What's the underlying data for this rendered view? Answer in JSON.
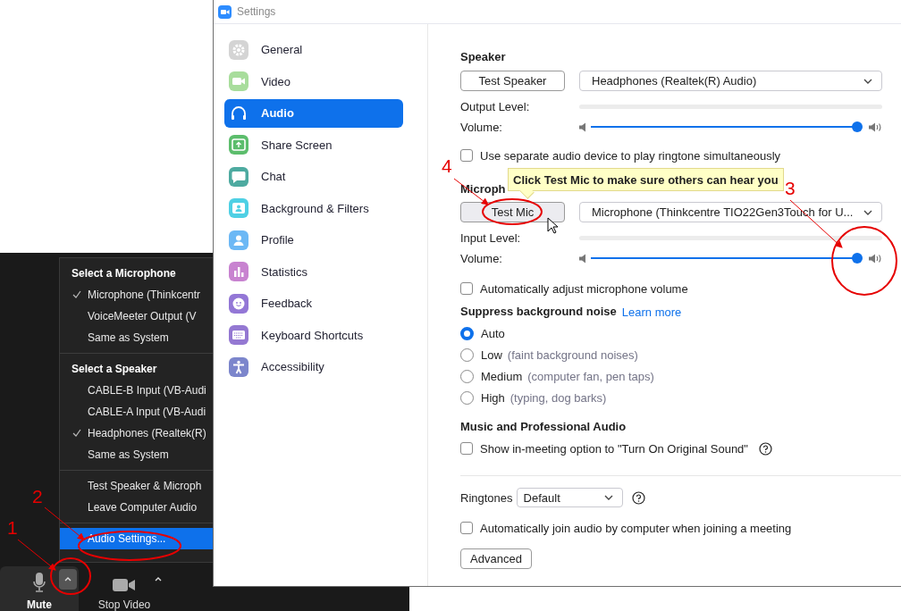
{
  "meeting": {
    "audio_menu": {
      "sections": [
        {
          "heading": "Select a Microphone",
          "items": [
            {
              "label": "Microphone (Thinkcentr",
              "checked": true,
              "selected": false
            },
            {
              "label": "VoiceMeeter Output (V",
              "checked": false,
              "selected": false
            },
            {
              "label": "Same as System",
              "checked": false,
              "selected": false
            }
          ]
        },
        {
          "heading": "Select a Speaker",
          "items": [
            {
              "label": "CABLE-B Input (VB-Audi",
              "checked": false,
              "selected": false
            },
            {
              "label": "CABLE-A Input (VB-Audi",
              "checked": false,
              "selected": false
            },
            {
              "label": "Headphones (Realtek(R)",
              "checked": true,
              "selected": false
            },
            {
              "label": "Same as System",
              "checked": false,
              "selected": false
            }
          ]
        },
        {
          "items": [
            {
              "label": "Test Speaker & Microph",
              "checked": false,
              "selected": false
            },
            {
              "label": "Leave Computer Audio",
              "checked": false,
              "selected": false
            }
          ]
        },
        {
          "items": [
            {
              "label": "Audio Settings...",
              "checked": false,
              "selected": true
            }
          ]
        }
      ]
    },
    "toolbar": [
      {
        "label": "Mute",
        "kind": "mic",
        "highlighted": true,
        "caret_highlighted": true
      },
      {
        "label": "Stop Video",
        "kind": "video",
        "highlighted": false,
        "caret_highlighted": false
      }
    ]
  },
  "settings_window": {
    "title": "Settings",
    "sidebar": [
      {
        "label": "General",
        "kind": "gear",
        "color": "#d4d4d4",
        "selected": false
      },
      {
        "label": "Video",
        "kind": "video",
        "color": "#a8dd9c",
        "selected": false
      },
      {
        "label": "Audio",
        "kind": "headphones",
        "selected": true
      },
      {
        "label": "Share Screen",
        "kind": "share",
        "color": "#5cbd6c",
        "selected": false
      },
      {
        "label": "Chat",
        "kind": "chat",
        "color": "#4daaa0",
        "selected": false
      },
      {
        "label": "Background & Filters",
        "kind": "background",
        "color": "#4fd0e4",
        "selected": false
      },
      {
        "label": "Profile",
        "kind": "profile",
        "color": "#6cb8f5",
        "selected": false
      },
      {
        "label": "Statistics",
        "kind": "statistics",
        "color": "#c883d0",
        "selected": false
      },
      {
        "label": "Feedback",
        "kind": "feedback",
        "color": "#9377d6",
        "selected": false
      },
      {
        "label": "Keyboard Shortcuts",
        "kind": "keyboard",
        "color": "#9478d2",
        "selected": false
      },
      {
        "label": "Accessibility",
        "kind": "accessibility",
        "color": "#7c86cc",
        "selected": false
      }
    ],
    "audio": {
      "speaker": {
        "heading": "Speaker",
        "test_button": "Test Speaker",
        "device": "Headphones (Realtek(R) Audio)",
        "meter": {
          "label": "Output Level:",
          "level": 0
        },
        "volume": {
          "label": "Volume:",
          "level": 1
        }
      },
      "ringtone_device": {
        "label": "Use separate audio device to play ringtone simultaneously",
        "checked": false
      },
      "microphone": {
        "heading": "Microph",
        "test_button": "Test Mic",
        "device": "Microphone (Thinkcentre TIO22Gen3Touch for U...",
        "meter": {
          "label": "Input Level:",
          "level": 0
        },
        "volume": {
          "label": "Volume:",
          "level": 1
        }
      },
      "auto_adjust": {
        "label": "Automatically adjust microphone volume",
        "checked": false
      },
      "suppress_noise": {
        "heading": "Suppress background noise",
        "link": "Learn more",
        "options": [
          {
            "label": "Auto",
            "selected": true
          },
          {
            "label": "Low",
            "hint": "(faint background noises)",
            "selected": false
          },
          {
            "label": "Medium",
            "hint": "(computer fan, pen taps)",
            "selected": false
          },
          {
            "label": "High",
            "hint": "(typing, dog barks)",
            "selected": false
          }
        ]
      },
      "music": {
        "heading": "Music and Professional Audio",
        "option": {
          "label": "Show in-meeting option to \"Turn On Original Sound\"",
          "checked": false
        }
      },
      "ringtones": {
        "label": "Ringtones",
        "value": "Default"
      },
      "auto_join": {
        "label": "Automatically join audio by computer when joining a meeting",
        "checked": false
      },
      "advanced_button": "Advanced"
    },
    "tooltip": "Click Test Mic to make sure others can hear you"
  },
  "annotations": [
    {
      "label": "1"
    },
    {
      "label": "2"
    },
    {
      "label": "3"
    },
    {
      "label": "4"
    }
  ]
}
